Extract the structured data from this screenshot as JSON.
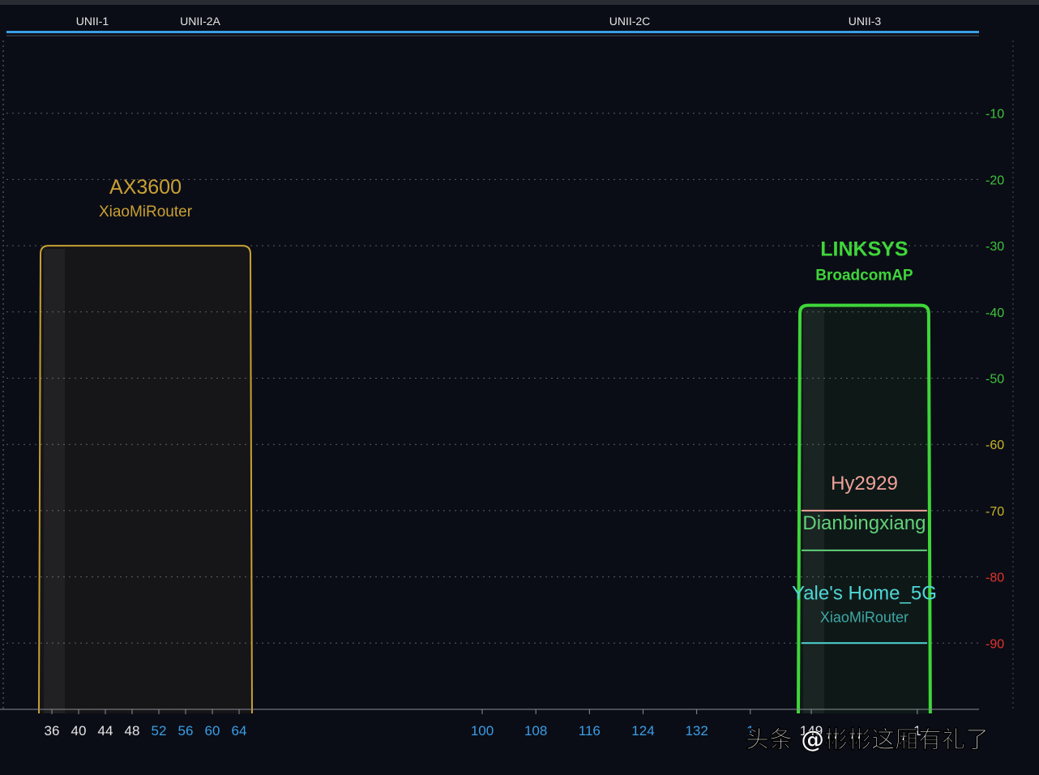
{
  "chart_data": {
    "type": "area",
    "title": "",
    "xlabel": "",
    "ylabel": "",
    "bands": [
      {
        "label": "UNII-1"
      },
      {
        "label": "UNII-2A"
      },
      {
        "label": "UNII-2C"
      },
      {
        "label": "UNII-3"
      }
    ],
    "y_ticks": [
      {
        "value": -10,
        "label": "-10",
        "color": "#3ec43c"
      },
      {
        "value": -20,
        "label": "-20",
        "color": "#3ec43c"
      },
      {
        "value": -30,
        "label": "-30",
        "color": "#3ec43c"
      },
      {
        "value": -40,
        "label": "-40",
        "color": "#3ec43c"
      },
      {
        "value": -50,
        "label": "-50",
        "color": "#3ec43c"
      },
      {
        "value": -60,
        "label": "-60",
        "color": "#c9b52a"
      },
      {
        "value": -70,
        "label": "-70",
        "color": "#c9b52a"
      },
      {
        "value": -80,
        "label": "-80",
        "color": "#e2342c"
      },
      {
        "value": -90,
        "label": "-90",
        "color": "#e2342c"
      }
    ],
    "x_ticks": [
      {
        "channel": 36,
        "label": "36",
        "color": "#e6e6e6"
      },
      {
        "channel": 40,
        "label": "40",
        "color": "#e6e6e6"
      },
      {
        "channel": 44,
        "label": "44",
        "color": "#e6e6e6"
      },
      {
        "channel": 48,
        "label": "48",
        "color": "#e6e6e6"
      },
      {
        "channel": 52,
        "label": "52",
        "color": "#3a9ee6"
      },
      {
        "channel": 56,
        "label": "56",
        "color": "#3a9ee6"
      },
      {
        "channel": 60,
        "label": "60",
        "color": "#3a9ee6"
      },
      {
        "channel": 64,
        "label": "64",
        "color": "#3a9ee6"
      },
      {
        "channel": 100,
        "label": "100",
        "color": "#3a9ee6"
      },
      {
        "channel": 108,
        "label": "108",
        "color": "#3a9ee6"
      },
      {
        "channel": 116,
        "label": "116",
        "color": "#3a9ee6"
      },
      {
        "channel": 124,
        "label": "124",
        "color": "#3a9ee6"
      },
      {
        "channel": 132,
        "label": "132",
        "color": "#3a9ee6"
      },
      {
        "channel": 140,
        "label": "1",
        "color": "#3a9ee6"
      },
      {
        "channel": 149,
        "label": "149",
        "color": "#e6e6e6"
      },
      {
        "channel": 165,
        "label": "1",
        "color": "#e6e6e6"
      }
    ],
    "series": [
      {
        "name": "AX3600",
        "vendor": "XiaoMiRouter",
        "channel_from": 36,
        "channel_to": 64,
        "signal": -30,
        "color": "#c9a033",
        "filled": true,
        "label_weight": "normal"
      },
      {
        "name": "LINKSYS",
        "vendor": "BroadcomAP",
        "channel_from": 149,
        "channel_to": 165,
        "signal": -39,
        "color": "#3ed63a",
        "filled": true,
        "label_weight": "bold"
      },
      {
        "name": "Hy2929",
        "vendor": "",
        "channel_from": 149,
        "channel_to": 165,
        "signal": -70,
        "color": "#f0a199",
        "filled": false,
        "label_weight": "normal"
      },
      {
        "name": "Dianbingxiang",
        "vendor": "",
        "channel_from": 149,
        "channel_to": 165,
        "signal": -76,
        "color": "#62d07a",
        "filled": false,
        "label_weight": "normal"
      },
      {
        "name": "Yale's Home_5G",
        "vendor": "XiaoMiRouter",
        "channel_from": 149,
        "channel_to": 165,
        "signal": -90,
        "color": "#4fd6d6",
        "filled": false,
        "label_weight": "normal"
      }
    ],
    "ylim": [
      -100,
      0
    ],
    "grid": true
  },
  "colors": {
    "background": "#0b0d16",
    "band_bar": "#3a9ee6",
    "grid": "#5a5e68",
    "axis": "#8a8e98"
  },
  "watermark": "头条 @彬彬这厢有礼了"
}
